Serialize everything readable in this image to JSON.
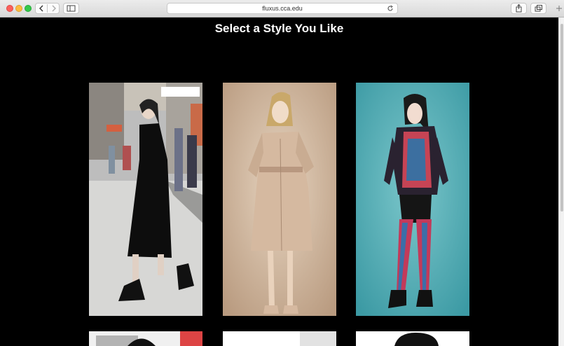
{
  "browser": {
    "url": "fluxus.cca.edu",
    "buttons": [
      "back",
      "forward",
      "sidebar",
      "reload",
      "share",
      "tabs",
      "new-tab"
    ]
  },
  "page": {
    "title": "Select a Style You Like"
  },
  "styles": [
    {
      "name": "street-style",
      "description": "woman in black midi dress walking on city street"
    },
    {
      "name": "trench-coat",
      "description": "model in beige trench coat on tan background"
    },
    {
      "name": "sporty",
      "description": "woman in patterned leggings on teal background"
    },
    {
      "name": "style-4"
    },
    {
      "name": "style-5"
    },
    {
      "name": "style-6"
    }
  ],
  "colors": {
    "background": "#000000",
    "title": "#ffffff",
    "teal": "#4db0b8",
    "tan": "#c7ad95"
  }
}
